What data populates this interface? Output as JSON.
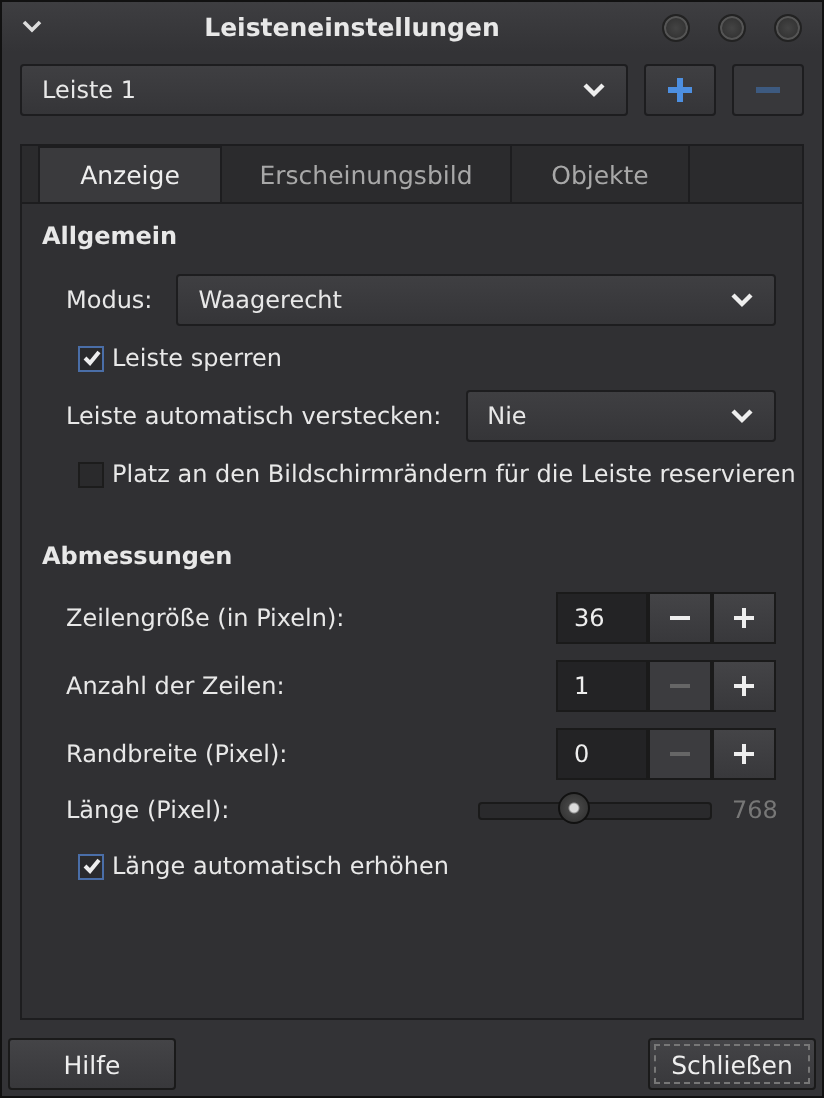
{
  "window": {
    "title": "Leisteneinstellungen"
  },
  "panel_select": {
    "value": "Leiste 1"
  },
  "add_button": {
    "disabled": false
  },
  "remove_button": {
    "disabled": true
  },
  "tabs": [
    {
      "label": "Anzeige",
      "selected": true
    },
    {
      "label": "Erscheinungsbild",
      "selected": false
    },
    {
      "label": "Objekte",
      "selected": false
    }
  ],
  "general": {
    "title": "Allgemein",
    "mode": {
      "label": "Modus:",
      "value": "Waagerecht"
    },
    "options": [
      {
        "kind": "check",
        "label": "Leiste sperren",
        "checked": true
      },
      {
        "kind": "select",
        "label": "Leiste automatisch verstecken:",
        "value": "Nie"
      },
      {
        "kind": "check",
        "label": "Platz an den Bildschirmrändern für die Leiste reservieren",
        "checked": false
      }
    ]
  },
  "dimensions": {
    "title": "Abmessungen",
    "spinners": [
      {
        "label": "Zeilengröße (in Pixeln):",
        "value": "36",
        "minus_disabled": false
      },
      {
        "label": "Anzahl der Zeilen:",
        "value": "1",
        "minus_disabled": true
      },
      {
        "label": "Randbreite (Pixel):",
        "value": "0",
        "minus_disabled": true
      }
    ],
    "length": {
      "label": "Länge (Pixel):",
      "level": 0.41,
      "reading": "768"
    },
    "auto_grow": {
      "label": "Länge automatisch erhöhen",
      "checked": true
    }
  },
  "buttons": [
    {
      "label": "Hilfe",
      "focused": false
    },
    {
      "label": "Schließen",
      "focused": true
    }
  ]
}
